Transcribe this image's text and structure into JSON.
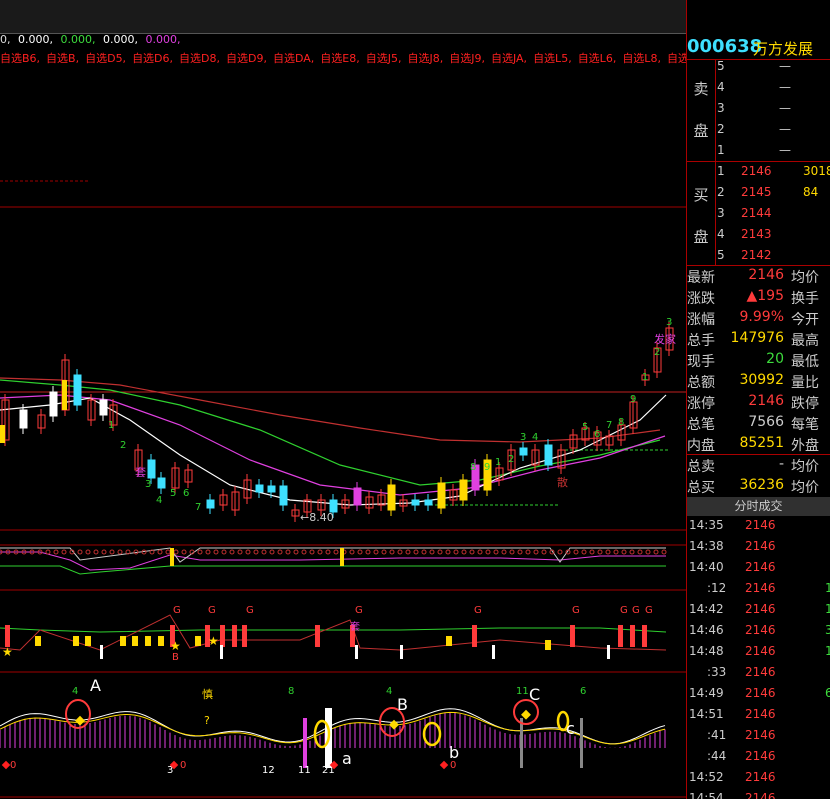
{
  "colors": {
    "up": "#ff3b3b",
    "down": "#3ee0ff",
    "accent": "#ffd900",
    "bg": "#000000",
    "grid": "#a00000",
    "ma_green": "#2fd02f",
    "ma_pink": "#e040e0",
    "ma_white": "#ffffff"
  },
  "header": {
    "values": [
      "0,",
      "0.000,",
      "0.000,",
      "0.000,",
      "0.000,"
    ],
    "markers": [
      "+",
      "+",
      "+",
      "+",
      "+"
    ]
  },
  "sel_tabs": [
    "自选B6,",
    "自选B,",
    "自选D5,",
    "自选D6,",
    "自选D8,",
    "自选D9,",
    "自选DA,",
    "自选E8,",
    "自选J5,",
    "自选J8,",
    "自选J9,",
    "自选JA,",
    "自选L5,",
    "自选L6,",
    "自选L8,",
    "自选L9,",
    "自选"
  ],
  "main_chart": {
    "low_label": "←8.40",
    "candle_labels": [
      "1",
      "2",
      "3",
      "4",
      "5",
      "6",
      "7",
      "8",
      "9",
      "1",
      "2",
      "3",
      "4",
      "5",
      "6",
      "7",
      "8",
      "9",
      "1",
      "2",
      "3",
      "4",
      "5",
      "6",
      "7",
      "8",
      "9"
    ],
    "tags": {
      "left_tag": "套",
      "right_tag": "散",
      "top_tag": "发家"
    }
  },
  "indicator3": {
    "markers_top": [
      "G",
      "G",
      "G",
      "G",
      "G",
      "G",
      "G",
      "G",
      "G",
      "G"
    ],
    "left_text": "B",
    "mid_text": "套"
  },
  "indicator4": {
    "labels": {
      "A": "A",
      "B": "B",
      "C": "C",
      "a": "a",
      "b": "b",
      "c": "c"
    },
    "numbers": [
      "4",
      "8",
      "4",
      "11",
      "6",
      "3",
      "12",
      "11",
      "21",
      "0",
      "0",
      "0"
    ],
    "mid_text": "慎",
    "q_text": "?"
  },
  "panel": {
    "stock_code": "000638",
    "stock_name": "万方发展",
    "sell_label_1": "卖",
    "sell_label_2": "盘",
    "buy_label_1": "买",
    "buy_label_2": "盘",
    "sell": [
      {
        "lvl": "5",
        "price": "—",
        "vol": ""
      },
      {
        "lvl": "4",
        "price": "—",
        "vol": ""
      },
      {
        "lvl": "3",
        "price": "—",
        "vol": ""
      },
      {
        "lvl": "2",
        "price": "—",
        "vol": ""
      },
      {
        "lvl": "1",
        "price": "—",
        "vol": ""
      }
    ],
    "buy": [
      {
        "lvl": "1",
        "price": "2146",
        "vol": "3018"
      },
      {
        "lvl": "2",
        "price": "2145",
        "vol": "84"
      },
      {
        "lvl": "3",
        "price": "2144",
        "vol": ""
      },
      {
        "lvl": "4",
        "price": "2143",
        "vol": ""
      },
      {
        "lvl": "5",
        "price": "2142",
        "vol": ""
      }
    ],
    "quote": [
      {
        "k": "最新",
        "v": "2146",
        "c": "#ff3b3b",
        "k2": "均价"
      },
      {
        "k": "涨跌",
        "v": "▲195",
        "c": "#ff3b3b",
        "k2": "换手"
      },
      {
        "k": "涨幅",
        "v": "9.99%",
        "c": "#ff3b3b",
        "k2": "今开"
      },
      {
        "k": "总手",
        "v": "147976",
        "c": "#ffd900",
        "k2": "最高"
      },
      {
        "k": "现手",
        "v": "20",
        "c": "#3ddc3d",
        "k2": "最低"
      },
      {
        "k": "总额",
        "v": "30992",
        "c": "#ffd900",
        "k2": "量比"
      },
      {
        "k": "涨停",
        "v": "2146",
        "c": "#ff3b3b",
        "k2": "跌停"
      },
      {
        "k": "总笔",
        "v": "7566",
        "c": "#ccc",
        "k2": "每笔"
      },
      {
        "k": "内盘",
        "v": "85251",
        "c": "#ffd900",
        "k2": "外盘"
      },
      {
        "k": "总卖",
        "v": "-",
        "c": "#ccc",
        "k2": "均价"
      },
      {
        "k": "总买",
        "v": "36236",
        "c": "#ffd900",
        "k2": "均价"
      }
    ],
    "ticks_title": "分时成交",
    "ticks": [
      {
        "t": "14:35",
        "p": "2146",
        "v": ""
      },
      {
        "t": "14:38",
        "p": "2146",
        "v": ""
      },
      {
        "t": "14:40",
        "p": "2146",
        "v": ""
      },
      {
        "t": ":12",
        "p": "2146",
        "v": "1"
      },
      {
        "t": "14:42",
        "p": "2146",
        "v": "1"
      },
      {
        "t": "14:46",
        "p": "2146",
        "v": "3"
      },
      {
        "t": "14:48",
        "p": "2146",
        "v": "1"
      },
      {
        "t": ":33",
        "p": "2146",
        "v": ""
      },
      {
        "t": "14:49",
        "p": "2146",
        "v": "6"
      },
      {
        "t": "14:51",
        "p": "2146",
        "v": ""
      },
      {
        "t": ":41",
        "p": "2146",
        "v": ""
      },
      {
        "t": ":44",
        "p": "2146",
        "v": ""
      },
      {
        "t": "14:52",
        "p": "2146",
        "v": ""
      },
      {
        "t": "14:54",
        "p": "2146",
        "v": ""
      }
    ]
  }
}
